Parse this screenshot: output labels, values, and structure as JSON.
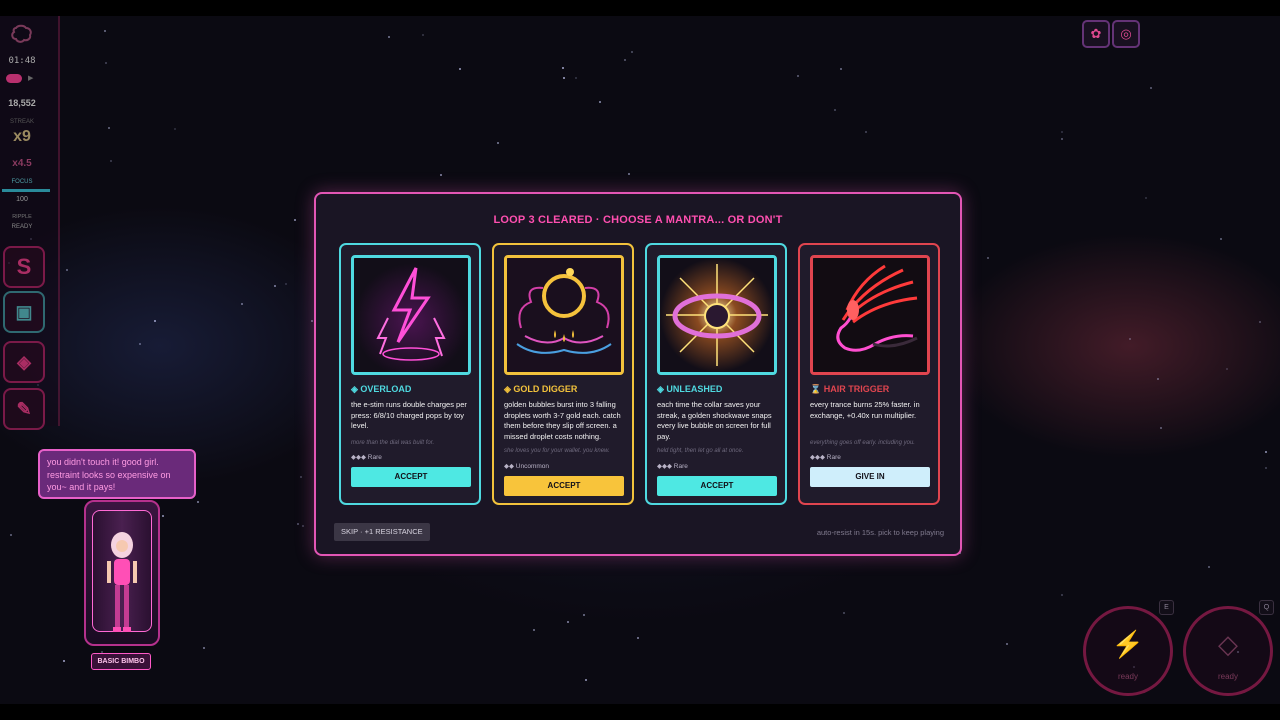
{
  "hud": {
    "timer": "01:48",
    "score": "18,552",
    "streak_label": "STREAK",
    "streak_value": "x9",
    "multiplier": "x4.5",
    "focus_label": "FOCUS",
    "focus_value": "100",
    "focus_fraction": 1.0,
    "ripple_label": "RIPPLE",
    "ripple_state": "READY"
  },
  "modal": {
    "title": "LOOP 3 CLEARED · CHOOSE A MANTRA... OR DON'T",
    "skip_label": "SKIP · +1 RESISTANCE",
    "auto_text": "auto-resist in 15s. pick to keep playing",
    "cards": [
      {
        "name": "OVERLOAD",
        "description": "the e-stim runs double charges per press: 6/8/10 charged pops by toy level.",
        "flavor": "more than the dial was built for.",
        "rarity": "◆◆◆ Rare",
        "button": "ACCEPT",
        "accent": "#4fd9e0",
        "button_color": "#4ee8e3",
        "icon": "lightning-icon"
      },
      {
        "name": "GOLD DIGGER",
        "description": "golden bubbles burst into 3 falling droplets worth 3-7 gold each. catch them before they slip off screen. a missed droplet costs nothing.",
        "flavor": "she loves you for your wallet. you knew.",
        "rarity": "◆◆ Uncommon",
        "button": "ACCEPT",
        "accent": "#f2c23c",
        "button_color": "#f8c43b",
        "icon": "gold-ring-icon"
      },
      {
        "name": "UNLEASHED",
        "description": "each time the collar saves your streak, a golden shockwave snaps every live bubble on screen for full pay.",
        "flavor": "held tight, then let go all at once.",
        "rarity": "◆◆◆ Rare",
        "button": "ACCEPT",
        "accent": "#4fd9e0",
        "button_color": "#4ee8e3",
        "icon": "collar-icon"
      },
      {
        "name": "HAIR TRIGGER",
        "description": "every trance burns 25% faster. in exchange, +0.40x run multiplier.",
        "flavor": "everything goes off early. including you.",
        "rarity": "◆◆◆ Rare",
        "button": "GIVE IN",
        "accent": "#e0454f",
        "button_color": "#cfeefb",
        "icon": "flame-whip-icon"
      }
    ]
  },
  "companion": {
    "speech": "you didn't touch it! good girl. restraint looks so expensive on you~ and it pays!",
    "name": "BASIC BIMBO"
  },
  "actions": [
    {
      "label": "ready",
      "key": "E",
      "icon": "lightning-icon"
    },
    {
      "label": "ready",
      "key": "Q",
      "icon": "diamond-icon"
    }
  ]
}
